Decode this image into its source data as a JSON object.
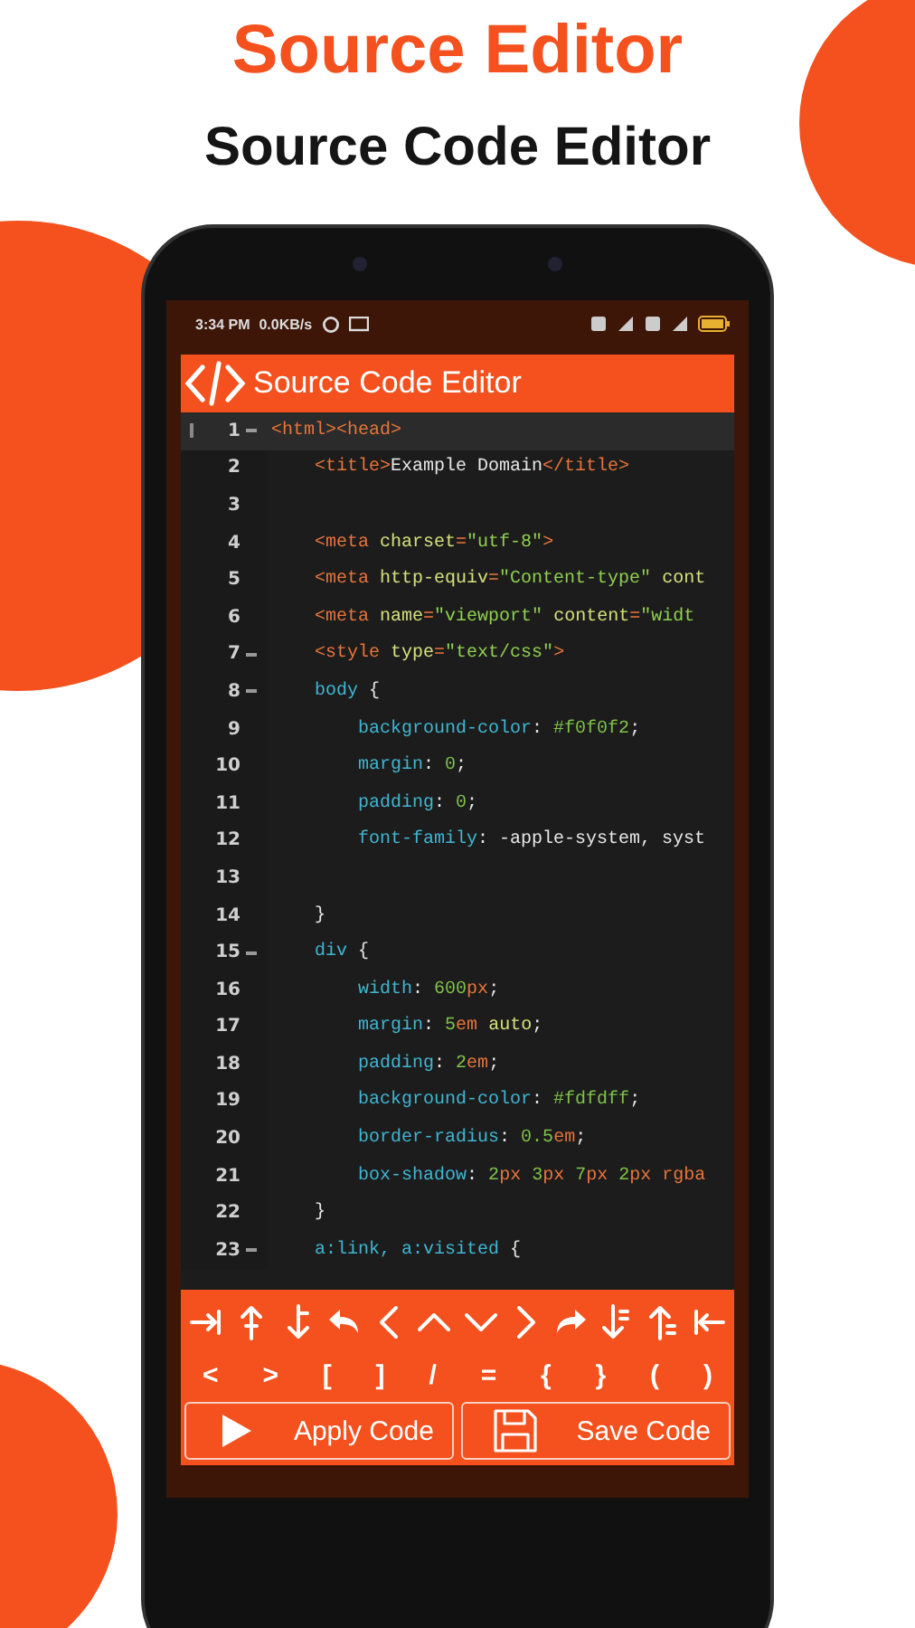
{
  "promo": {
    "title": "Source Editor",
    "subtitle": "Source Code Editor"
  },
  "status_bar": {
    "time": "3:34 PM",
    "speed": "0.0KB/s"
  },
  "app_bar": {
    "title": "Source Code Editor"
  },
  "editor": {
    "lines": [
      {
        "number": "1",
        "active": true,
        "foldable": true,
        "tokens": [
          {
            "kind": "tag",
            "text": "<html><head>"
          }
        ]
      },
      {
        "number": "2",
        "active": false,
        "foldable": false,
        "tokens": [
          {
            "kind": "tag",
            "text": "    <title>"
          },
          {
            "kind": "text",
            "text": "Example Domain"
          },
          {
            "kind": "tag",
            "text": "</title>"
          }
        ]
      },
      {
        "number": "3",
        "active": false,
        "foldable": false
      },
      {
        "number": "4",
        "active": false,
        "foldable": false,
        "tokens": [
          {
            "kind": "tag",
            "text": "    <meta "
          },
          {
            "kind": "attr",
            "text": "charset"
          },
          {
            "kind": "tag",
            "text": "="
          },
          {
            "kind": "string",
            "text": "\"utf-8\""
          },
          {
            "kind": "tag",
            "text": ">"
          }
        ]
      },
      {
        "number": "5",
        "active": false,
        "foldable": false,
        "tokens": [
          {
            "kind": "tag",
            "text": "    <meta "
          },
          {
            "kind": "attr",
            "text": "http-equiv"
          },
          {
            "kind": "tag",
            "text": "="
          },
          {
            "kind": "string",
            "text": "\"Content-type\""
          },
          {
            "kind": "attr",
            "text": " cont"
          }
        ]
      },
      {
        "number": "6",
        "active": false,
        "foldable": false,
        "tokens": [
          {
            "kind": "tag",
            "text": "    <meta "
          },
          {
            "kind": "attr",
            "text": "name"
          },
          {
            "kind": "tag",
            "text": "="
          },
          {
            "kind": "string",
            "text": "\"viewport\""
          },
          {
            "kind": "attr",
            "text": " content"
          },
          {
            "kind": "tag",
            "text": "="
          },
          {
            "kind": "string",
            "text": "\"widt"
          }
        ]
      },
      {
        "number": "7",
        "active": false,
        "foldable": true,
        "tokens": [
          {
            "kind": "tag",
            "text": "    <style "
          },
          {
            "kind": "attr",
            "text": "type"
          },
          {
            "kind": "tag",
            "text": "="
          },
          {
            "kind": "string",
            "text": "\"text/css\""
          },
          {
            "kind": "tag",
            "text": ">"
          }
        ]
      },
      {
        "number": "8",
        "active": false,
        "foldable": true,
        "tokens": [
          {
            "kind": "selector",
            "text": "    body"
          },
          {
            "kind": "text",
            "text": " {"
          }
        ]
      },
      {
        "number": "9",
        "active": false,
        "foldable": false,
        "tokens": [
          {
            "kind": "prop",
            "text": "        background-color"
          },
          {
            "kind": "text",
            "text": ": "
          },
          {
            "kind": "number",
            "text": "#f0f0f2"
          },
          {
            "kind": "text",
            "text": ";"
          }
        ]
      },
      {
        "number": "10",
        "active": false,
        "foldable": false,
        "tokens": [
          {
            "kind": "prop",
            "text": "        margin"
          },
          {
            "kind": "text",
            "text": ": "
          },
          {
            "kind": "number",
            "text": "0"
          },
          {
            "kind": "text",
            "text": ";"
          }
        ]
      },
      {
        "number": "11",
        "active": false,
        "foldable": false,
        "tokens": [
          {
            "kind": "prop",
            "text": "        padding"
          },
          {
            "kind": "text",
            "text": ": "
          },
          {
            "kind": "number",
            "text": "0"
          },
          {
            "kind": "text",
            "text": ";"
          }
        ]
      },
      {
        "number": "12",
        "active": false,
        "foldable": false,
        "tokens": [
          {
            "kind": "prop",
            "text": "        font-family"
          },
          {
            "kind": "text",
            "text": ": -apple-system, syst"
          }
        ]
      },
      {
        "number": "13",
        "active": false,
        "foldable": false
      },
      {
        "number": "14",
        "active": false,
        "foldable": false,
        "tokens": [
          {
            "kind": "text",
            "text": "    }"
          }
        ]
      },
      {
        "number": "15",
        "active": false,
        "foldable": true,
        "tokens": [
          {
            "kind": "selector",
            "text": "    div"
          },
          {
            "kind": "text",
            "text": " {"
          }
        ]
      },
      {
        "number": "16",
        "active": false,
        "foldable": false,
        "tokens": [
          {
            "kind": "prop",
            "text": "        width"
          },
          {
            "kind": "text",
            "text": ": "
          },
          {
            "kind": "number",
            "text": "600"
          },
          {
            "kind": "unit",
            "text": "px"
          },
          {
            "kind": "text",
            "text": ";"
          }
        ]
      },
      {
        "number": "17",
        "active": false,
        "foldable": false,
        "tokens": [
          {
            "kind": "prop",
            "text": "        margin"
          },
          {
            "kind": "text",
            "text": ": "
          },
          {
            "kind": "number",
            "text": "5"
          },
          {
            "kind": "unit",
            "text": "em"
          },
          {
            "kind": "attr",
            "text": " auto"
          },
          {
            "kind": "text",
            "text": ";"
          }
        ]
      },
      {
        "number": "18",
        "active": false,
        "foldable": false,
        "tokens": [
          {
            "kind": "prop",
            "text": "        padding"
          },
          {
            "kind": "text",
            "text": ": "
          },
          {
            "kind": "number",
            "text": "2"
          },
          {
            "kind": "unit",
            "text": "em"
          },
          {
            "kind": "text",
            "text": ";"
          }
        ]
      },
      {
        "number": "19",
        "active": false,
        "foldable": false,
        "tokens": [
          {
            "kind": "prop",
            "text": "        background-color"
          },
          {
            "kind": "text",
            "text": ": "
          },
          {
            "kind": "number",
            "text": "#fdfdff"
          },
          {
            "kind": "text",
            "text": ";"
          }
        ]
      },
      {
        "number": "20",
        "active": false,
        "foldable": false,
        "tokens": [
          {
            "kind": "prop",
            "text": "        border-radius"
          },
          {
            "kind": "text",
            "text": ": "
          },
          {
            "kind": "number",
            "text": "0.5"
          },
          {
            "kind": "unit",
            "text": "em"
          },
          {
            "kind": "text",
            "text": ";"
          }
        ]
      },
      {
        "number": "21",
        "active": false,
        "foldable": false,
        "tokens": [
          {
            "kind": "prop",
            "text": "        box-shadow"
          },
          {
            "kind": "text",
            "text": ": "
          },
          {
            "kind": "number",
            "text": "2"
          },
          {
            "kind": "unit",
            "text": "px "
          },
          {
            "kind": "number",
            "text": "3"
          },
          {
            "kind": "unit",
            "text": "px "
          },
          {
            "kind": "number",
            "text": "7"
          },
          {
            "kind": "unit",
            "text": "px "
          },
          {
            "kind": "number",
            "text": "2"
          },
          {
            "kind": "unit",
            "text": "px rgba"
          }
        ]
      },
      {
        "number": "22",
        "active": false,
        "foldable": false,
        "tokens": [
          {
            "kind": "text",
            "text": "    }"
          }
        ]
      },
      {
        "number": "23",
        "active": false,
        "foldable": true,
        "tokens": [
          {
            "kind": "selector",
            "text": "    a:link, a:visited"
          },
          {
            "kind": "text",
            "text": " {"
          }
        ]
      }
    ]
  },
  "symbol_keys": [
    "<",
    ">",
    "[",
    "]",
    "/",
    "=",
    "{",
    "}",
    "(",
    ")"
  ],
  "actions": [
    {
      "kind": "apply",
      "label": "Apply Code"
    },
    {
      "kind": "save",
      "label": "Save Code"
    }
  ]
}
